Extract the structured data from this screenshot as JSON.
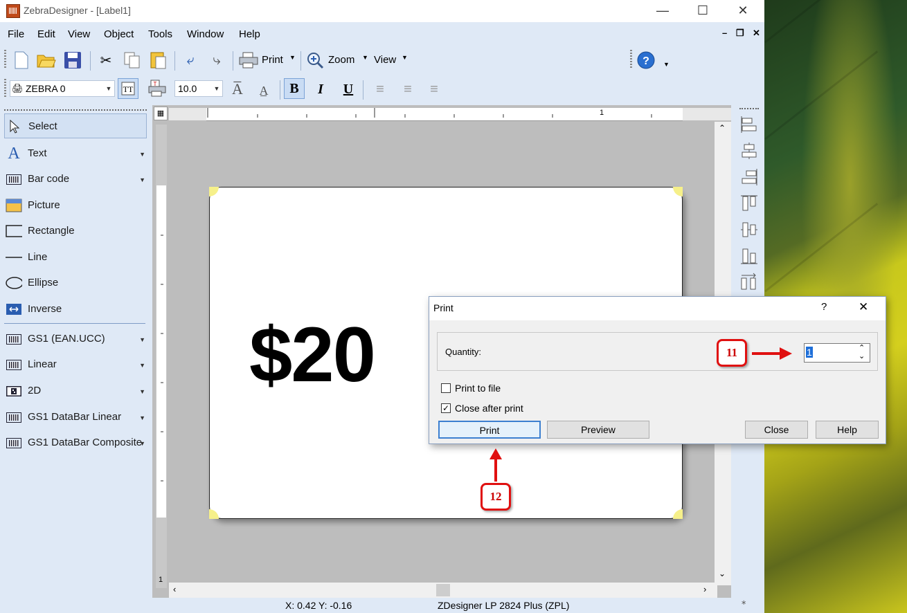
{
  "window": {
    "title": "ZebraDesigner - [Label1]"
  },
  "menu": [
    "File",
    "Edit",
    "View",
    "Object",
    "Tools",
    "Window",
    "Help"
  ],
  "toolbar": {
    "print_label": "Print",
    "zoom_label": "Zoom",
    "view_label": "View"
  },
  "format_toolbar": {
    "printer_font": "ZEBRA 0",
    "font_size": "10.0"
  },
  "left_panel": {
    "tools": [
      {
        "label": "Select",
        "icon": "pointer-icon"
      },
      {
        "label": "Text",
        "icon": "text-icon"
      },
      {
        "label": "Bar code",
        "icon": "barcode-icon"
      },
      {
        "label": "Picture",
        "icon": "picture-icon"
      },
      {
        "label": "Rectangle",
        "icon": "rectangle-icon"
      },
      {
        "label": "Line",
        "icon": "line-icon"
      },
      {
        "label": "Ellipse",
        "icon": "ellipse-icon"
      },
      {
        "label": "Inverse",
        "icon": "inverse-icon"
      }
    ],
    "barcodes": [
      {
        "label": "GS1 (EAN.UCC)"
      },
      {
        "label": "Linear"
      },
      {
        "label": "2D"
      },
      {
        "label": "GS1 DataBar Linear"
      },
      {
        "label": "GS1 DataBar Composite"
      }
    ]
  },
  "label": {
    "text": "$20"
  },
  "ruler": {
    "mark": "1"
  },
  "status": {
    "coords": "X:  0.42 Y: -0.16",
    "printer": "ZDesigner LP 2824 Plus (ZPL)"
  },
  "print_dialog": {
    "title": "Print",
    "help_glyph": "?",
    "quantity_label": "Quantity:",
    "quantity_value": "1",
    "print_to_file": "Print to file",
    "close_after_print": "Close after print",
    "close_after_print_checked": true,
    "buttons": {
      "print": "Print",
      "preview": "Preview",
      "close": "Close",
      "help": "Help"
    }
  },
  "annotations": {
    "step_quantity": "11",
    "step_print": "12"
  },
  "colors": {
    "accent": "#e01010",
    "panel": "#dfe9f6",
    "label_corner": "#f6f08a"
  }
}
